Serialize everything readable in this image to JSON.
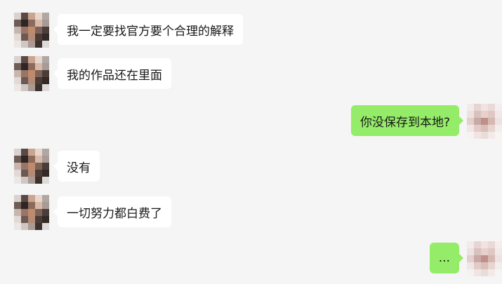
{
  "messages": [
    {
      "sender": "other",
      "text": "我一定要找官方要个合理的解释"
    },
    {
      "sender": "other",
      "text": "我的作品还在里面"
    },
    {
      "sender": "self",
      "text": "你没保存到本地?"
    },
    {
      "sender": "other",
      "text": "没有"
    },
    {
      "sender": "other",
      "text": "一切努力都白费了"
    },
    {
      "sender": "self",
      "text": "..."
    }
  ],
  "colors": {
    "background": "#f5f5f5",
    "incoming_bubble": "#ffffff",
    "outgoing_bubble": "#95ec69",
    "text": "#181818"
  }
}
